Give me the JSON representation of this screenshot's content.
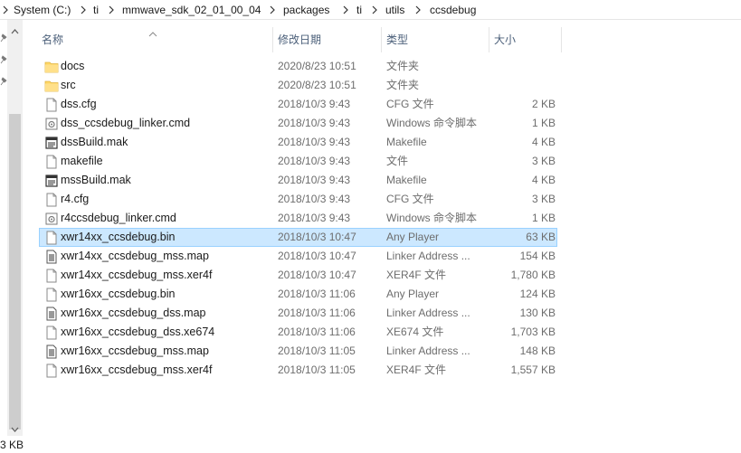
{
  "breadcrumb": {
    "segments": [
      "System (C:)",
      "ti",
      "mmwave_sdk_02_01_00_04",
      "packages",
      "ti",
      "utils",
      "ccsdebug"
    ]
  },
  "columns": {
    "name": "名称",
    "date": "修改日期",
    "type": "类型",
    "size": "大小"
  },
  "status": {
    "fragment": "3 KB"
  },
  "colors": {
    "selection_bg": "#cce8ff",
    "selection_border": "#99d1ff",
    "folder": "#ffd766"
  },
  "files": [
    {
      "name": "docs",
      "date": "2020/8/23 10:51",
      "type": "文件夹",
      "size": "",
      "icon": "folder-icon"
    },
    {
      "name": "src",
      "date": "2020/8/23 10:51",
      "type": "文件夹",
      "size": "",
      "icon": "folder-icon"
    },
    {
      "name": "dss.cfg",
      "date": "2018/10/3 9:43",
      "type": "CFG 文件",
      "size": "2 KB",
      "icon": "file-icon"
    },
    {
      "name": "dss_ccsdebug_linker.cmd",
      "date": "2018/10/3 9:43",
      "type": "Windows 命令脚本",
      "size": "1 KB",
      "icon": "cmd-script-icon"
    },
    {
      "name": "dssBuild.mak",
      "date": "2018/10/3 9:43",
      "type": "Makefile",
      "size": "4 KB",
      "icon": "makefile-icon"
    },
    {
      "name": "makefile",
      "date": "2018/10/3 9:43",
      "type": "文件",
      "size": "3 KB",
      "icon": "file-icon"
    },
    {
      "name": "mssBuild.mak",
      "date": "2018/10/3 9:43",
      "type": "Makefile",
      "size": "4 KB",
      "icon": "makefile-icon"
    },
    {
      "name": "r4.cfg",
      "date": "2018/10/3 9:43",
      "type": "CFG 文件",
      "size": "3 KB",
      "icon": "file-icon"
    },
    {
      "name": "r4ccsdebug_linker.cmd",
      "date": "2018/10/3 9:43",
      "type": "Windows 命令脚本",
      "size": "1 KB",
      "icon": "cmd-script-icon"
    },
    {
      "name": "xwr14xx_ccsdebug.bin",
      "date": "2018/10/3 10:47",
      "type": "Any Player",
      "size": "63 KB",
      "icon": "file-icon",
      "selected": true
    },
    {
      "name": "xwr14xx_ccsdebug_mss.map",
      "date": "2018/10/3 10:47",
      "type": "Linker Address ...",
      "size": "154 KB",
      "icon": "text-file-icon"
    },
    {
      "name": "xwr14xx_ccsdebug_mss.xer4f",
      "date": "2018/10/3 10:47",
      "type": "XER4F 文件",
      "size": "1,780 KB",
      "icon": "file-icon"
    },
    {
      "name": "xwr16xx_ccsdebug.bin",
      "date": "2018/10/3 11:06",
      "type": "Any Player",
      "size": "124 KB",
      "icon": "file-icon"
    },
    {
      "name": "xwr16xx_ccsdebug_dss.map",
      "date": "2018/10/3 11:06",
      "type": "Linker Address ...",
      "size": "130 KB",
      "icon": "text-file-icon"
    },
    {
      "name": "xwr16xx_ccsdebug_dss.xe674",
      "date": "2018/10/3 11:06",
      "type": "XE674 文件",
      "size": "1,703 KB",
      "icon": "file-icon"
    },
    {
      "name": "xwr16xx_ccsdebug_mss.map",
      "date": "2018/10/3 11:05",
      "type": "Linker Address ...",
      "size": "148 KB",
      "icon": "text-file-icon"
    },
    {
      "name": "xwr16xx_ccsdebug_mss.xer4f",
      "date": "2018/10/3 11:05",
      "type": "XER4F 文件",
      "size": "1,557 KB",
      "icon": "file-icon"
    }
  ]
}
